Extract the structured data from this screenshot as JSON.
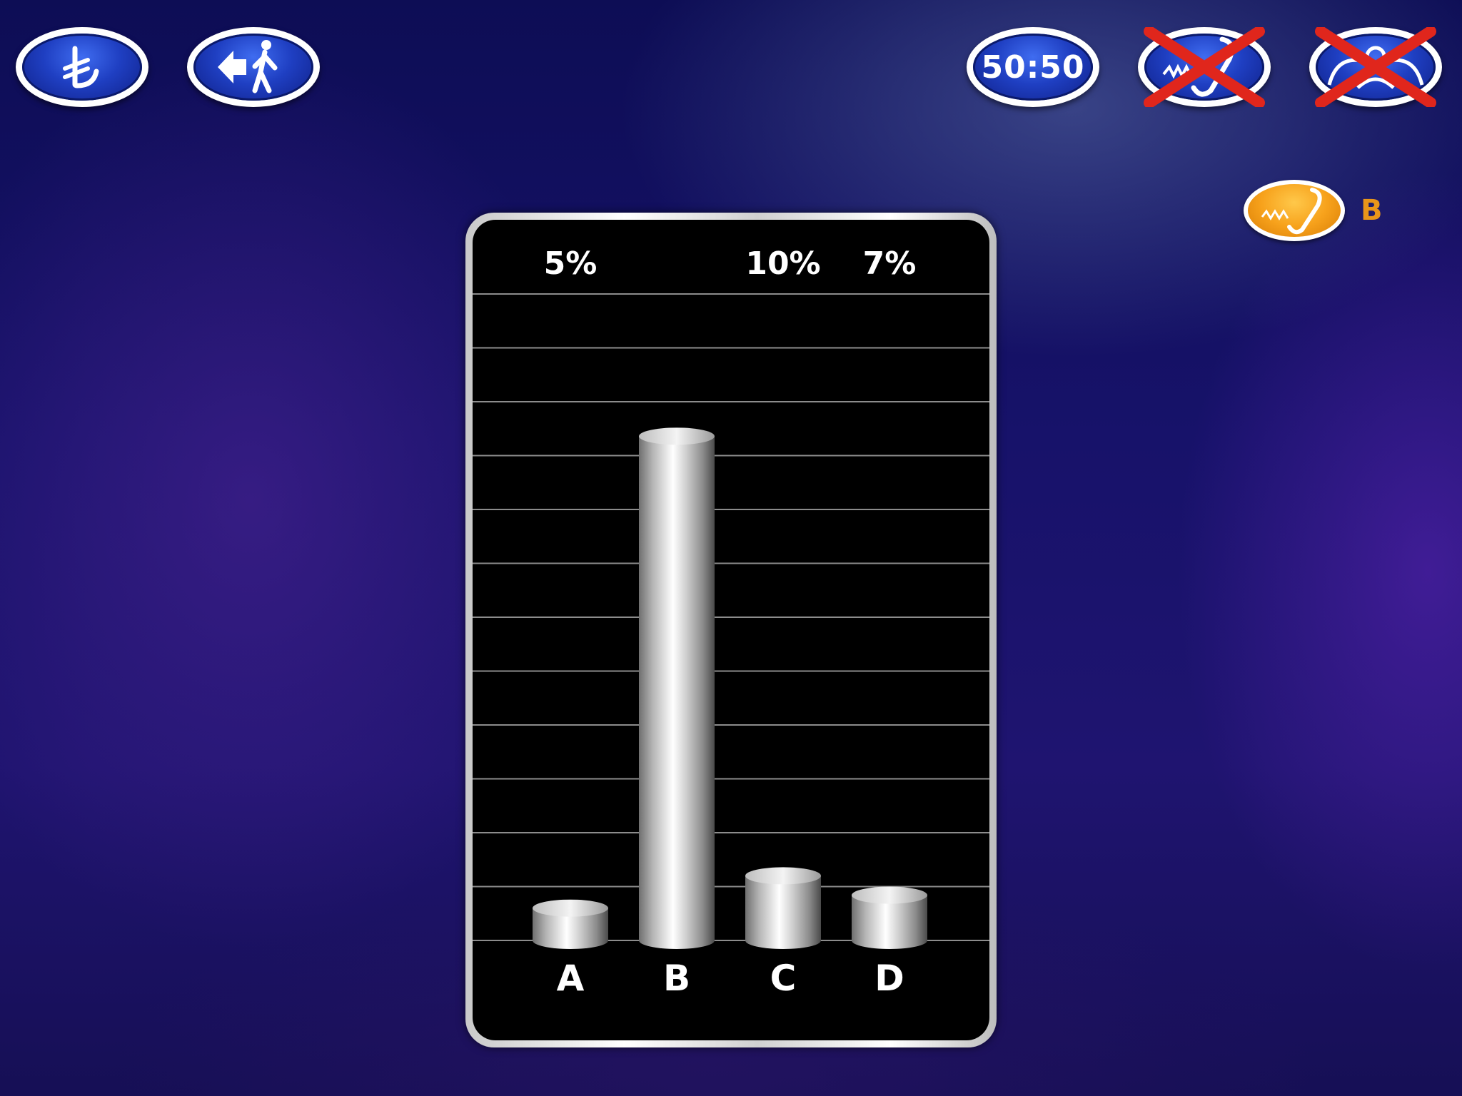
{
  "lifelines": {
    "money_icon": "lira-icon",
    "walk_away_icon": "walk-away-icon",
    "fifty_fifty_label": "50:50",
    "phone_icon": "phone-a-friend-icon",
    "audience_icon": "ask-the-audience-icon",
    "phone_used": true,
    "audience_used": true
  },
  "phone_result": {
    "icon": "phone-icon",
    "answer": "B"
  },
  "colors": {
    "lifeline_blue": "#1f3fc2",
    "used_cross": "#e0261c",
    "phone_orange": "#f7a21c",
    "answer_text": "#e8961a"
  },
  "chart_data": {
    "type": "bar",
    "categories": [
      "A",
      "B",
      "C",
      "D"
    ],
    "values": [
      5,
      78,
      10,
      7
    ],
    "labels": [
      "5%",
      "",
      "10%",
      "7%"
    ],
    "ylim": [
      0,
      100
    ],
    "grid": true
  }
}
